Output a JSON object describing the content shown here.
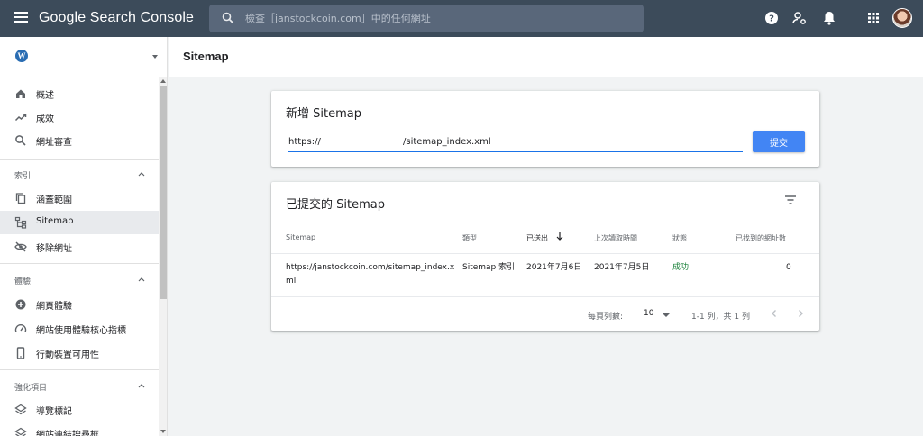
{
  "app": {
    "title": "Google Search Console",
    "search_placeholder": "檢查［janstockcoin.com］中的任何網址",
    "icons": [
      "menu-icon",
      "search-icon",
      "help-icon",
      "manage-users-icon",
      "bell-icon",
      "apps-grid-icon",
      "avatar"
    ]
  },
  "sidebar": {
    "property_icon": "wordpress-icon",
    "nav_top": [
      {
        "label": "概述",
        "icon": "home-icon"
      },
      {
        "label": "成效",
        "icon": "trending-up-icon"
      },
      {
        "label": "網址審查",
        "icon": "search-icon"
      }
    ],
    "sections": [
      {
        "title": "索引",
        "items": [
          {
            "label": "涵蓋範圍",
            "icon": "copy-icon"
          },
          {
            "label": "Sitemap",
            "icon": "sitemap-icon",
            "active": true
          },
          {
            "label": "移除網址",
            "icon": "visibility-off-icon"
          }
        ]
      },
      {
        "title": "體驗",
        "items": [
          {
            "label": "網頁體驗",
            "icon": "add-circle-icon"
          },
          {
            "label": "網站使用體驗核心指標",
            "icon": "speed-icon"
          },
          {
            "label": "行動裝置可用性",
            "icon": "phone-icon"
          }
        ]
      },
      {
        "title": "強化項目",
        "items": [
          {
            "label": "導覽標記",
            "icon": "layers-icon"
          },
          {
            "label": "網站連結搜尋框",
            "icon": "layers-icon"
          }
        ]
      }
    ]
  },
  "page": {
    "title": "Sitemap"
  },
  "add_card": {
    "title": "新增 Sitemap",
    "url_prefix": "https://",
    "url_suffix": "/sitemap_index.xml",
    "submit_label": "提交"
  },
  "submitted_card": {
    "title": "已提交的 Sitemap",
    "columns": [
      "Sitemap",
      "類型",
      "已送出",
      "上次讀取時間",
      "狀態",
      "已找到的網址數"
    ],
    "rows": [
      {
        "sitemap_line1": "https://janstockcoin.com/sitemap_index.x",
        "sitemap_line2": "ml",
        "type": "Sitemap 索引",
        "submitted": "2021年7月6日",
        "last_read": "2021年7月5日",
        "status": "成功",
        "urls_found": "0"
      }
    ],
    "pager": {
      "rows_per_page_label": "每頁列數:",
      "rows_per_page_value": "10",
      "range_label": "1-1 列，共 1 列"
    }
  },
  "colors": {
    "appbar": "#3c4b5a",
    "accent": "#4285f4",
    "success": "#188038"
  }
}
